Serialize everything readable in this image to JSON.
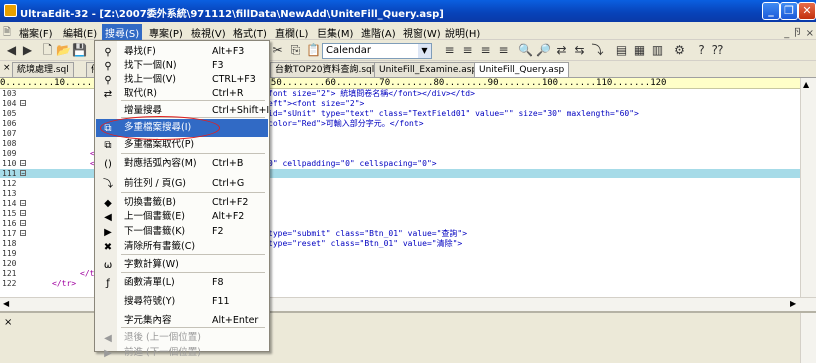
{
  "window": {
    "title": "UltraEdit-32 - [Z:\\2007委外系統\\971112\\fillData\\NewAdd\\UniteFill_Query.asp]",
    "mdi_buttons": "_ 卪 ×"
  },
  "menubar": [
    {
      "label": "檔案(F)"
    },
    {
      "label": "編輯(E)"
    },
    {
      "label": "搜尋(S)"
    },
    {
      "label": "專案(P)"
    },
    {
      "label": "檢視(V)"
    },
    {
      "label": "格式(T)"
    },
    {
      "label": "直欄(L)"
    },
    {
      "label": "巨集(M)"
    },
    {
      "label": "進階(A)"
    },
    {
      "label": "視窗(W)"
    },
    {
      "label": "說明(H)"
    }
  ],
  "toolbar": {
    "calendar_combo": "Calendar"
  },
  "tabs": [
    {
      "label": "統境處理.sql"
    },
    {
      "label": "備"
    },
    {
      "label": "台數TOP20資料查詢.sql"
    },
    {
      "label": "UniteFill_Examine.asp"
    },
    {
      "label": "UniteFill_Query.asp"
    }
  ],
  "ruler": "0.........10........20........30........40........50........60........70........80........90........100.......110.......120",
  "editor": {
    "lines": [
      {
        "num": "103",
        "fold": "",
        "code": "font size=\"2\"> 統填問卷名稱</font></div></td>",
        "hl": false
      },
      {
        "num": "104",
        "fold": "−",
        "code": "eft\"><font size=\"2\">",
        "hl": false
      },
      {
        "num": "105",
        "fold": "",
        "code": "id=\"sUnit\" type=\"text\" class=\"TextField01\" value=\"\" size=\"30\" maxlength=\"60\">",
        "hl": false
      },
      {
        "num": "106",
        "fold": "",
        "code": "color=\"Red\">可輸入部分字元。</font>",
        "hl": false
      },
      {
        "num": "107",
        "fold": "",
        "code": "",
        "hl": false
      },
      {
        "num": "108",
        "fold": "",
        "code": "",
        "hl": false
      },
      {
        "num": "109",
        "fold": "",
        "code": "",
        "hl": false
      },
      {
        "num": "110",
        "fold": "−",
        "code": "0\" cellpadding=\"0\" cellspacing=\"0\">",
        "hl": false
      },
      {
        "num": "111",
        "fold": "−",
        "code": "",
        "hl": true
      },
      {
        "num": "112",
        "fold": "",
        "code": "",
        "hl": false
      },
      {
        "num": "113",
        "fold": "",
        "code": "",
        "hl": false
      },
      {
        "num": "114",
        "fold": "−",
        "code": "",
        "hl": false
      },
      {
        "num": "115",
        "fold": "−",
        "code": "",
        "hl": false
      },
      {
        "num": "116",
        "fold": "−",
        "code": "",
        "hl": false
      },
      {
        "num": "117",
        "fold": "−",
        "code": "type=\"submit\" class=\"Btn_01\" value=\"查詢\">",
        "hl": false
      },
      {
        "num": "118",
        "fold": "",
        "code": "type=\"reset\" class=\"Btn_01\" value=\"清除\">",
        "hl": false
      },
      {
        "num": "119",
        "fold": "",
        "code": "",
        "hl": false
      },
      {
        "num": "120",
        "fold": "",
        "code": "",
        "hl": false
      },
      {
        "num": "121",
        "fold": "",
        "code": "",
        "hl": false
      },
      {
        "num": "122",
        "fold": "",
        "code": "",
        "hl": false
      }
    ],
    "left_fragments": {
      "l109": "</",
      "l110": "<t",
      "l121": "</ta",
      "l122": "</tr>"
    }
  },
  "search_menu": {
    "items": [
      {
        "icon": "binoculars",
        "label": "尋找(F)",
        "shortcut": "Alt+F3",
        "enabled": true
      },
      {
        "icon": "find-next",
        "label": "找下一個(N)",
        "shortcut": "F3",
        "enabled": true
      },
      {
        "icon": "find-prev",
        "label": "找上一個(V)",
        "shortcut": "CTRL+F3",
        "enabled": true
      },
      {
        "icon": "replace",
        "label": "取代(R)",
        "shortcut": "Ctrl+R",
        "enabled": true
      },
      {
        "icon": "",
        "label": "增量搜尋",
        "shortcut": "Ctrl+Shift+I",
        "enabled": true
      },
      {
        "icon": "multi-file-find",
        "label": "多重檔案搜尋(I)",
        "shortcut": "",
        "enabled": true
      },
      {
        "icon": "multi-file-replace",
        "label": "多重檔案取代(P)",
        "shortcut": "",
        "enabled": true
      },
      {
        "icon": "brace-match",
        "label": "對應括弧內容(M)",
        "shortcut": "Ctrl+B",
        "enabled": true
      },
      {
        "icon": "goto",
        "label": "前往列 / 頁(G)",
        "shortcut": "Ctrl+G",
        "enabled": true
      },
      {
        "icon": "bookmark-toggle",
        "label": "切換書籤(B)",
        "shortcut": "Ctrl+F2",
        "enabled": true
      },
      {
        "icon": "bookmark-prev",
        "label": "上一個書籤(E)",
        "shortcut": "Alt+F2",
        "enabled": true
      },
      {
        "icon": "bookmark-next",
        "label": "下一個書籤(K)",
        "shortcut": "F2",
        "enabled": true
      },
      {
        "icon": "bookmark-clear",
        "label": "清除所有書籤(C)",
        "shortcut": "",
        "enabled": true
      },
      {
        "icon": "word-count",
        "label": "字數計算(W)",
        "shortcut": "",
        "enabled": true
      },
      {
        "icon": "function-list",
        "label": "函數清單(L)",
        "shortcut": "F8",
        "enabled": true
      },
      {
        "icon": "",
        "label": "搜尋符號(Y)",
        "shortcut": "F11",
        "enabled": true
      },
      {
        "icon": "",
        "label": "字元集內容",
        "shortcut": "Alt+Enter",
        "enabled": true
      },
      {
        "icon": "back",
        "label": "退後 (上一個位置)",
        "shortcut": "",
        "enabled": false
      },
      {
        "icon": "forward",
        "label": "前進 (下一個位置)",
        "shortcut": "",
        "enabled": false
      }
    ],
    "highlight_index": 5
  }
}
